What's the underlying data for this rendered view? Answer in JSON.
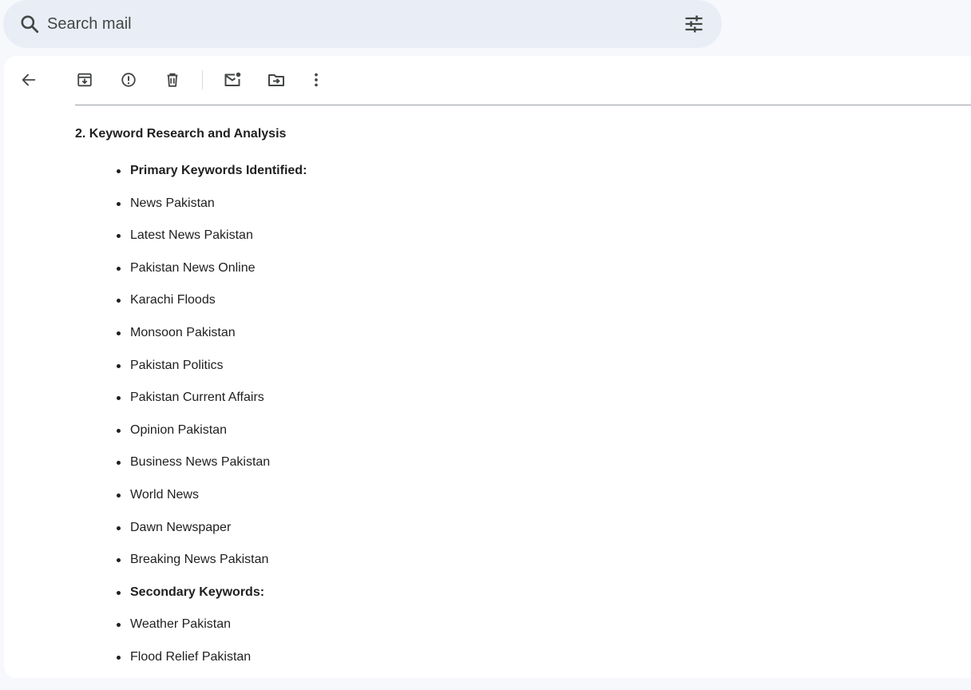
{
  "search": {
    "placeholder": "Search mail"
  },
  "toolbar": {
    "icons": [
      "back-arrow-icon",
      "archive-icon",
      "report-spam-icon",
      "delete-icon",
      "mark-unread-icon",
      "move-to-icon",
      "more-options-icon"
    ]
  },
  "email": {
    "section_heading": "2. Keyword Research and Analysis",
    "items": [
      {
        "label": "Primary Keywords Identified:",
        "bold": true
      },
      {
        "label": "News Pakistan",
        "bold": false
      },
      {
        "label": "Latest News Pakistan",
        "bold": false
      },
      {
        "label": "Pakistan News Online",
        "bold": false
      },
      {
        "label": "Karachi Floods",
        "bold": false
      },
      {
        "label": "Monsoon Pakistan",
        "bold": false
      },
      {
        "label": "Pakistan Politics",
        "bold": false
      },
      {
        "label": "Pakistan Current Affairs",
        "bold": false
      },
      {
        "label": "Opinion Pakistan",
        "bold": false
      },
      {
        "label": "Business News Pakistan",
        "bold": false
      },
      {
        "label": "World News",
        "bold": false
      },
      {
        "label": "Dawn Newspaper",
        "bold": false
      },
      {
        "label": "Breaking News Pakistan",
        "bold": false
      },
      {
        "label": "Secondary Keywords:",
        "bold": true
      },
      {
        "label": "Weather Pakistan",
        "bold": false
      },
      {
        "label": "Flood Relief Pakistan",
        "bold": false
      }
    ]
  },
  "colors": {
    "background": "#f6f8fc",
    "search_bg": "#e9eef6",
    "icon": "#444746",
    "text": "#1f1f1f"
  }
}
